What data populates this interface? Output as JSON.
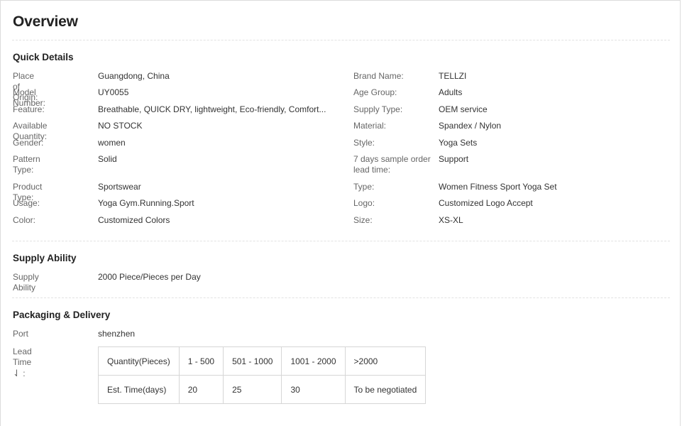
{
  "page": {
    "title": "Overview"
  },
  "quick_details": {
    "title": "Quick Details",
    "left": [
      {
        "label": "Place of Origin:",
        "value": "Guangdong, China"
      },
      {
        "label": "Model Number:",
        "value": "UY0055"
      },
      {
        "label": "Feature:",
        "value": "Breathable, QUICK DRY, lightweight, Eco-friendly, Comfort..."
      },
      {
        "label": "Available Quantity:",
        "value": "NO STOCK"
      },
      {
        "label": "Gender:",
        "value": "women"
      },
      {
        "label": "Pattern Type:",
        "value": "Solid"
      },
      {
        "label": "Product Type:",
        "value": "Sportswear"
      },
      {
        "label": "Usage:",
        "value": "Yoga Gym.Running.Sport"
      },
      {
        "label": "Color:",
        "value": "Customized Colors"
      }
    ],
    "right": [
      {
        "label": "Brand Name:",
        "value": "TELLZI"
      },
      {
        "label": "Age Group:",
        "value": "Adults"
      },
      {
        "label": "Supply Type:",
        "value": "OEM service"
      },
      {
        "label": "Material:",
        "value": "Spandex / Nylon"
      },
      {
        "label": "Style:",
        "value": "Yoga Sets"
      },
      {
        "label": "7 days sample order lead time:",
        "value": "Support"
      },
      {
        "label": "Type:",
        "value": "Women Fitness Sport Yoga Set"
      },
      {
        "label": "Logo:",
        "value": "Customized Logo Accept"
      },
      {
        "label": "Size:",
        "value": "XS-XL"
      }
    ]
  },
  "supply_ability": {
    "title": "Supply Ability",
    "label": "Supply Ability",
    "value": "2000 Piece/Pieces per Day"
  },
  "packaging": {
    "title": "Packaging & Delivery",
    "port_label": "Port",
    "port_value": "shenzhen",
    "lead_time_label": "Lead Time",
    "lead_time_arrow": "⇃",
    "lead_time_colon": " :",
    "table": {
      "header": [
        "Quantity(Pieces)",
        "1 - 500",
        "501 - 1000",
        "1001 - 2000",
        ">2000"
      ],
      "row": [
        "Est. Time(days)",
        "20",
        "25",
        "30",
        "To be negotiated"
      ]
    }
  }
}
